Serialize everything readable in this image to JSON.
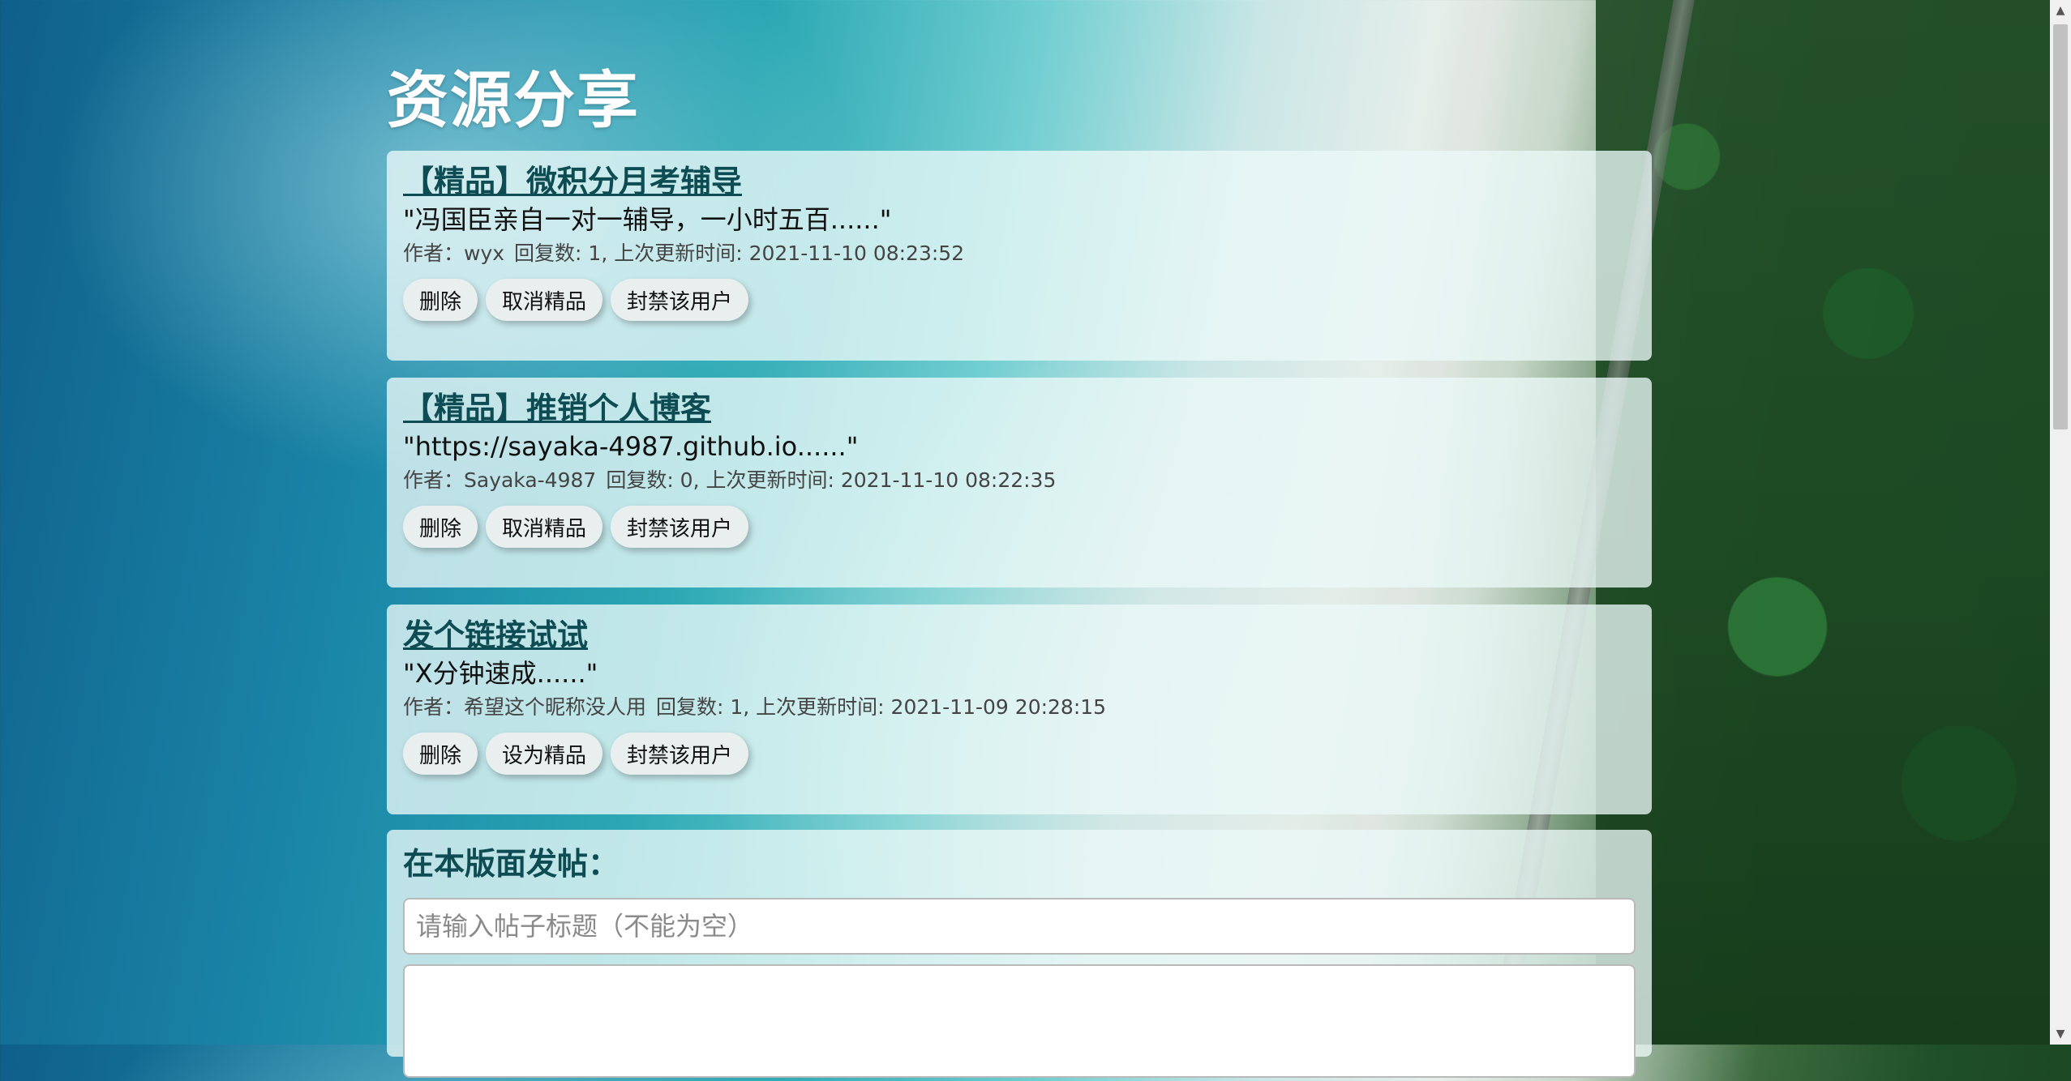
{
  "page": {
    "title": "资源分享"
  },
  "posts": [
    {
      "title": "【精品】微积分月考辅导",
      "excerpt": "\"冯国臣亲自一对一辅导，一小时五百......\"",
      "author": "作者：wyx",
      "stats": "回复数: 1, 上次更新时间: 2021-11-10 08:23:52",
      "buttons": {
        "delete": "删除",
        "feature": "取消精品",
        "ban": "封禁该用户"
      }
    },
    {
      "title": "【精品】推销个人博客",
      "excerpt": "\"https://sayaka-4987.github.io......\"",
      "author": "作者：Sayaka-4987",
      "stats": "回复数: 0, 上次更新时间: 2021-11-10 08:22:35",
      "buttons": {
        "delete": "删除",
        "feature": "取消精品",
        "ban": "封禁该用户"
      }
    },
    {
      "title": "发个链接试试",
      "excerpt": "\"X分钟速成......\"",
      "author": "作者：希望这个昵称没人用",
      "stats": "回复数: 1, 上次更新时间: 2021-11-09 20:28:15",
      "buttons": {
        "delete": "删除",
        "feature": "设为精品",
        "ban": "封禁该用户"
      }
    }
  ],
  "compose": {
    "heading": "在本版面发帖：",
    "title_placeholder": "请输入帖子标题（不能为空）",
    "content_value": ""
  },
  "scrollbar": {
    "up_icon": "▲",
    "down_icon": "▼"
  }
}
